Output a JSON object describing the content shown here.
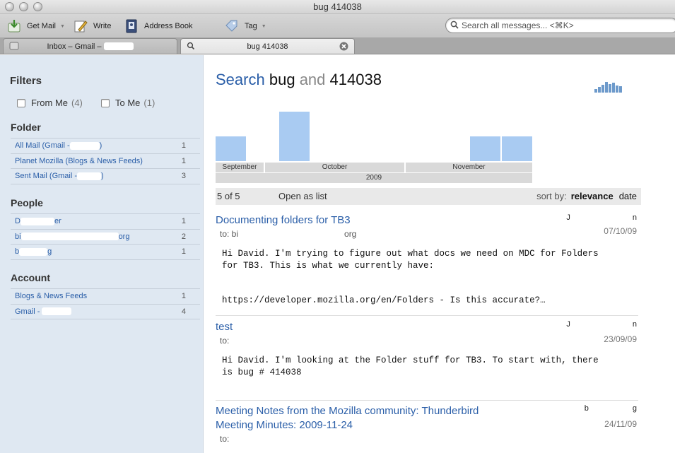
{
  "window": {
    "title": "bug 414038"
  },
  "toolbar": {
    "get_mail": "Get Mail",
    "write": "Write",
    "address_book": "Address Book",
    "tag": "Tag",
    "search_placeholder": "Search all messages... <⌘K>"
  },
  "tabs": [
    {
      "label": "Inbox – Gmail – "
    },
    {
      "label": "bug 414038"
    }
  ],
  "sidebar": {
    "filters_title": "Filters",
    "from_me": {
      "label": "From Me",
      "count": "(4)"
    },
    "to_me": {
      "label": "To Me",
      "count": "(1)"
    },
    "folder_title": "Folder",
    "folders": [
      {
        "label": "All Mail (Gmail -",
        "suffix": ")",
        "count": "1"
      },
      {
        "label": "Planet Mozilla (Blogs & News Feeds)",
        "suffix": "",
        "count": "1"
      },
      {
        "label": "Sent Mail (Gmail -",
        "suffix": ")",
        "count": "3"
      }
    ],
    "people_title": "People",
    "people": [
      {
        "label": "D",
        "suffix": "er",
        "count": "1"
      },
      {
        "label": "bi",
        "suffix": "org",
        "count": "2"
      },
      {
        "label": "b",
        "suffix": "g",
        "count": "1"
      }
    ],
    "account_title": "Account",
    "accounts": [
      {
        "label": "Blogs & News Feeds",
        "suffix": "",
        "count": "1"
      },
      {
        "label": "Gmail -",
        "suffix": "",
        "count": "4"
      }
    ]
  },
  "search": {
    "prefix": "Search",
    "term1": "bug",
    "conj": "and",
    "term2": "414038"
  },
  "chart_data": {
    "type": "bar",
    "months": [
      "September",
      "October",
      "November"
    ],
    "year": "2009",
    "bars": [
      {
        "month": "September",
        "value": 1
      },
      {
        "month": "October",
        "value": 2
      },
      {
        "month": "November",
        "value": 1
      },
      {
        "month": "November",
        "value": 1
      }
    ],
    "color": "#a9cbf2"
  },
  "results": {
    "count": "5 of 5",
    "open_as_list": "Open as list",
    "sort_by": "sort by:",
    "sort_relevance": "relevance",
    "sort_date": "date"
  },
  "messages": [
    {
      "subject": "Documenting folders for TB3",
      "to": "to: bi",
      "to_suffix": "org",
      "from": "J",
      "from_suffix": "n",
      "date": "07/10/09",
      "body": "Hi David. I'm trying to figure out what docs we need on MDC for Folders\nfor TB3. This is what we currently have:\n\n\nhttps://developer.mozilla.org/en/Folders - Is this accurate?…"
    },
    {
      "subject": "test",
      "to": "to:",
      "to_suffix": "",
      "from": "J",
      "from_suffix": "n",
      "date": "23/09/09",
      "body": "Hi David. I'm looking at the Folder stuff for TB3. To start with, there\nis bug # 414038"
    },
    {
      "subject": "Meeting Notes from the Mozilla community: Thunderbird\nMeeting Minutes: 2009-11-24",
      "to": "to:",
      "to_suffix": "",
      "from": "b",
      "from_suffix": "g",
      "date": "24/11/09",
      "body": ""
    }
  ]
}
